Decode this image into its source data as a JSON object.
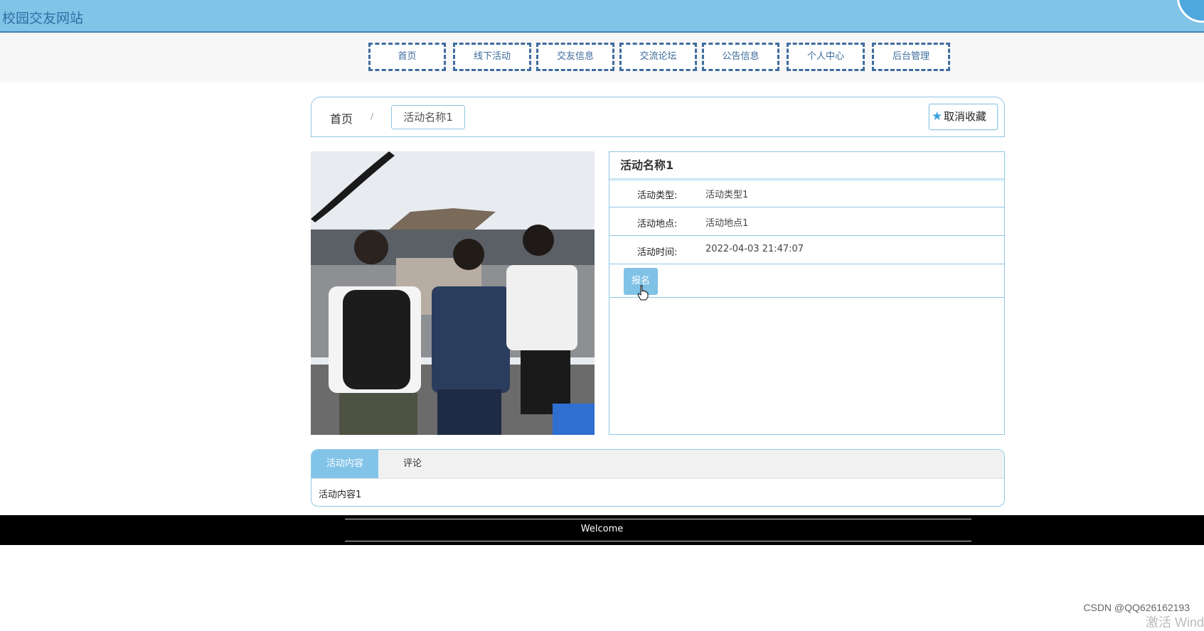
{
  "header": {
    "site_title": "校园交友网站"
  },
  "nav": {
    "items": [
      "首页",
      "线下活动",
      "交友信息",
      "交流论坛",
      "公告信息",
      "个人中心",
      "后台管理"
    ]
  },
  "breadcrumb": {
    "home": "首页",
    "separator": "/",
    "current": "活动名称1"
  },
  "favorite": {
    "label": "取消收藏",
    "icon": "star-icon"
  },
  "activity": {
    "title": "活动名称1",
    "fields": [
      {
        "label": "活动类型:",
        "value": "活动类型1"
      },
      {
        "label": "活动地点:",
        "value": "活动地点1"
      },
      {
        "label": "活动时间:",
        "value": "2022-04-03 21:47:07"
      }
    ],
    "signup_label": "报名"
  },
  "tabs": {
    "items": [
      "活动内容",
      "评论"
    ],
    "active": "活动内容",
    "content": "活动内容1"
  },
  "footer": {
    "text": "Welcome"
  },
  "watermark": {
    "csdn": "CSDN @QQ626162193",
    "win": "激活 Wind"
  },
  "colors": {
    "header_bg": "#82c3e8",
    "accent": "#80c1e6",
    "nav_border": "#3f6c9e",
    "panel_border": "#8fc7e6"
  }
}
